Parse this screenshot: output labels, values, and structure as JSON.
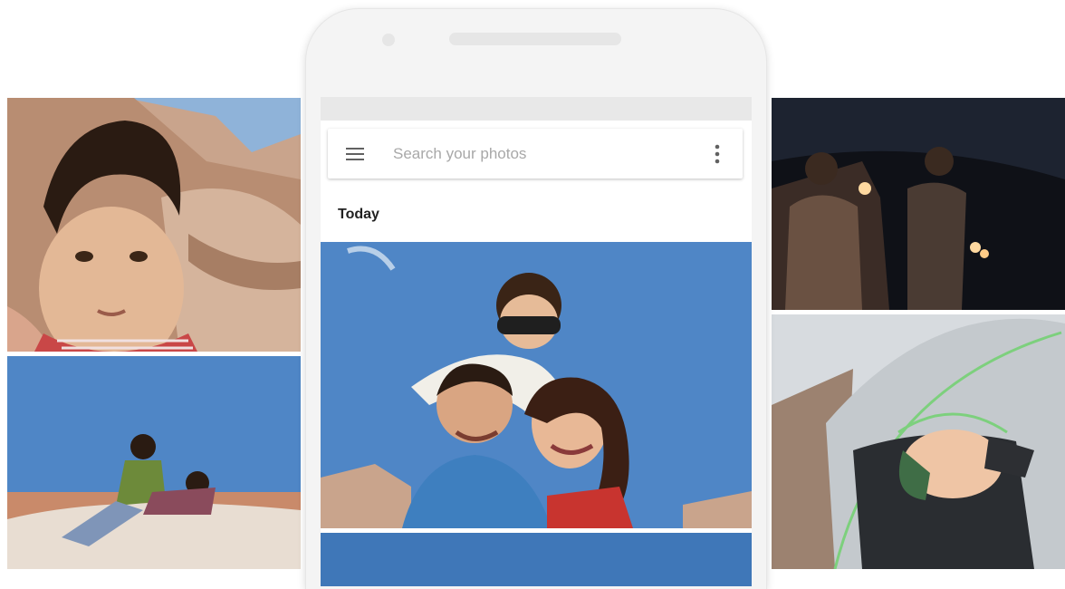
{
  "search": {
    "placeholder": "Search your photos",
    "menu_icon": "hamburger-menu-icon",
    "more_icon": "more-vert-icon"
  },
  "gallery": {
    "section_label": "Today"
  },
  "colors": {
    "sky": "#4f86c6",
    "rock": "#c9a48c",
    "night": "#1d2330"
  }
}
